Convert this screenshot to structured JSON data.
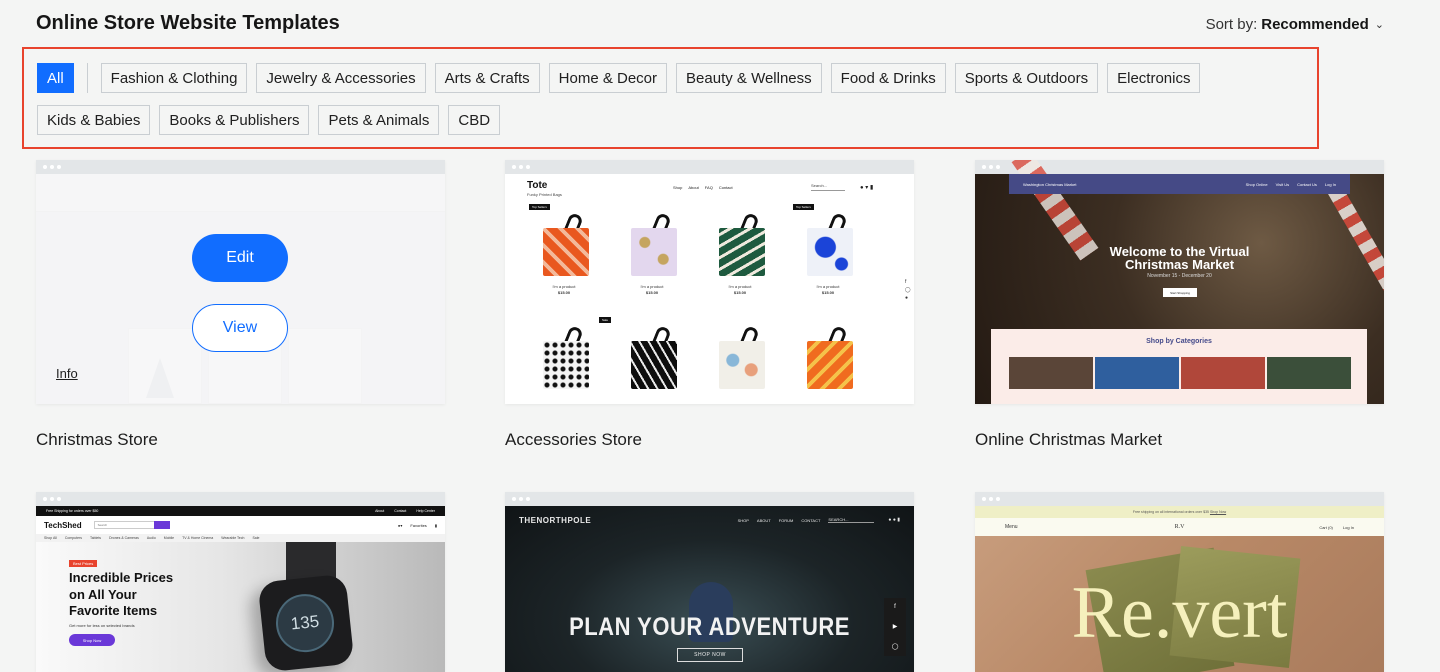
{
  "page": {
    "title": "Online Store Website Templates",
    "sort_label": "Sort by:",
    "sort_value": "Recommended"
  },
  "categories": [
    "All",
    "Fashion & Clothing",
    "Jewelry & Accessories",
    "Arts & Crafts",
    "Home & Decor",
    "Beauty & Wellness",
    "Food & Drinks",
    "Sports & Outdoors",
    "Electronics",
    "Kids & Babies",
    "Books & Publishers",
    "Pets & Animals",
    "CBD"
  ],
  "colors": {
    "accent": "#116dff",
    "highlight_border": "#e8432d",
    "background": "#f4f5f4"
  },
  "templates": [
    {
      "name": "Christmas Store",
      "edit_label": "Edit",
      "view_label": "View",
      "info_label": "Info"
    },
    {
      "name": "Accessories Store",
      "preview": {
        "brand": "Tote",
        "tagline": "Funky Printed Bags",
        "nav": [
          "Shop",
          "About",
          "FAQ",
          "Contact"
        ],
        "search": "Search...",
        "badge_top_seller": "Top Sellers",
        "badge_sale": "Sale",
        "products": [
          {
            "name": "I'm a product",
            "price": "$15.00"
          },
          {
            "name": "I'm a product",
            "price": "$15.00"
          },
          {
            "name": "I'm a product",
            "price": "$15.00"
          },
          {
            "name": "I'm a product",
            "price": "$15.00"
          }
        ]
      }
    },
    {
      "name": "Online Christmas Market",
      "preview": {
        "site_name": "Washington Christmas Market",
        "nav": [
          "Shop Online",
          "Visit Us",
          "Contact Us",
          "Log In"
        ],
        "hero_line1": "Welcome to the Virtual",
        "hero_line2": "Christmas Market",
        "dates": "November 15 - December 20",
        "cta": "Start Shopping",
        "categories_title": "Shop by Categories"
      }
    },
    {
      "name": "TechShed",
      "preview": {
        "promo": "Free Shipping for orders over $50",
        "promo_links": [
          "About",
          "Contact",
          "Help Center"
        ],
        "logo": "TechShed",
        "search": "Search",
        "favorites": "Favorites",
        "menu": [
          "Shop All",
          "Computers",
          "Tablets",
          "Drones & Cameras",
          "Audio",
          "Mobile",
          "TV & Home Cinema",
          "Wearable Tech",
          "Sale"
        ],
        "badge": "Best Prices",
        "headline_1": "Incredible Prices",
        "headline_2": "on All Your",
        "headline_3": "Favorite Items",
        "subtext": "Get more for less on selected brands",
        "cta": "Shop Now",
        "watch_face": "135"
      }
    },
    {
      "name": "The North Pole",
      "preview": {
        "logo": "THENORTHPOLE",
        "nav": [
          "SHOP",
          "ABOUT",
          "FORUM",
          "CONTACT"
        ],
        "search": "SEARCH...",
        "headline": "PLAN YOUR ADVENTURE",
        "cta": "SHOP NOW"
      }
    },
    {
      "name": "Re.vert",
      "preview": {
        "promo": "Free shipping on all international orders over $35",
        "promo_link": "Shop Now",
        "menu": "Menu",
        "brand_small": "R.V",
        "cart": "Cart (0)",
        "login": "Log In",
        "headline": "Re.vert"
      }
    }
  ]
}
